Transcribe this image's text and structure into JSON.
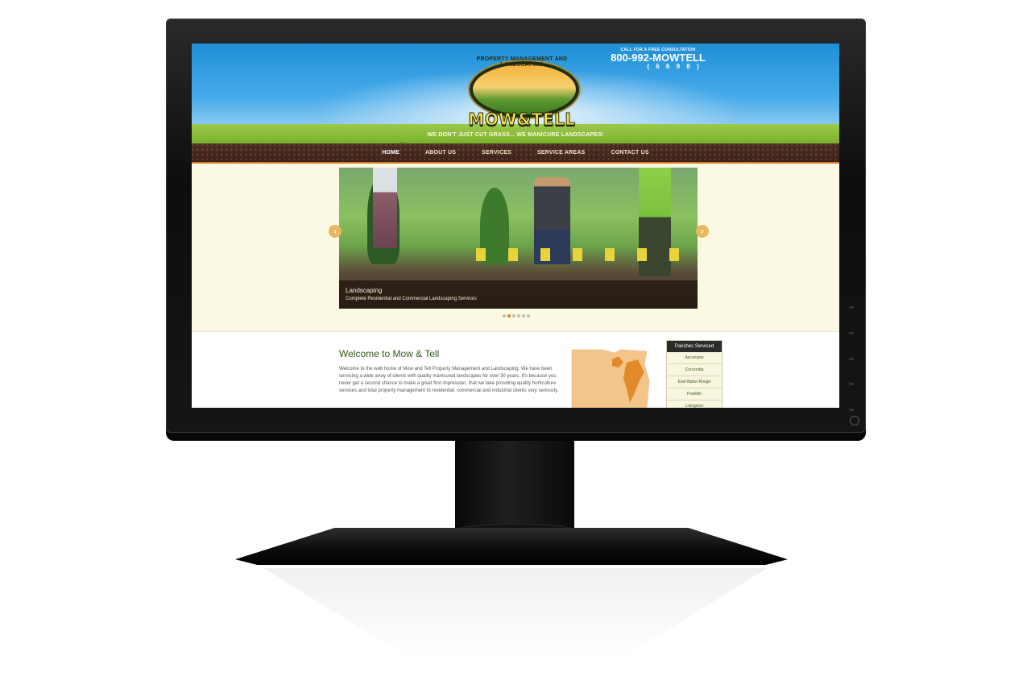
{
  "site": {
    "logo_arc": "PROPERTY MANAGEMENT AND LANDSCAPING",
    "logo_word": "MOW&TELL",
    "tagline": "WE DON'T JUST CUT GRASS... WE MANICURE LANDSCAPES!"
  },
  "contact": {
    "call_label": "CALL FOR A FREE CONSULTATION",
    "phone": "800-992-MOWTELL",
    "digits": "( 6 6 9 8 )"
  },
  "nav": {
    "items": [
      {
        "label": "HOME",
        "active": true
      },
      {
        "label": "ABOUT US"
      },
      {
        "label": "SERVICES"
      },
      {
        "label": "SERVICE AREAS"
      },
      {
        "label": "CONTACT US"
      }
    ]
  },
  "slider": {
    "title": "Landscaping",
    "text": "Complete Residential and Commercial Landscaping Services",
    "prev_icon": "chevron-left-icon",
    "next_icon": "chevron-right-icon",
    "slide_count": 6,
    "active_index": 1
  },
  "welcome": {
    "title": "Welcome to Mow & Tell",
    "text": "Welcome to the web home of Mow and Tell Property Management and Landscaping. We have been servicing a wide array of clients with quality manicured landscapes for over 30 years. It's because you never get a second chance to make a great first impression, that we take providing quality horticulture services and total property management to residential, commercial and industrial clients very seriously."
  },
  "parishes": {
    "heading": "Parishes Serviced",
    "items": [
      "Ascension",
      "Concordia",
      "East Baton Rouge",
      "Franklin",
      "Livingston"
    ]
  },
  "colors": {
    "nav_bg": "#3b2219",
    "accent_orange": "#d87a25",
    "title_green": "#2f5a1a",
    "sky_blue": "#49acea"
  }
}
